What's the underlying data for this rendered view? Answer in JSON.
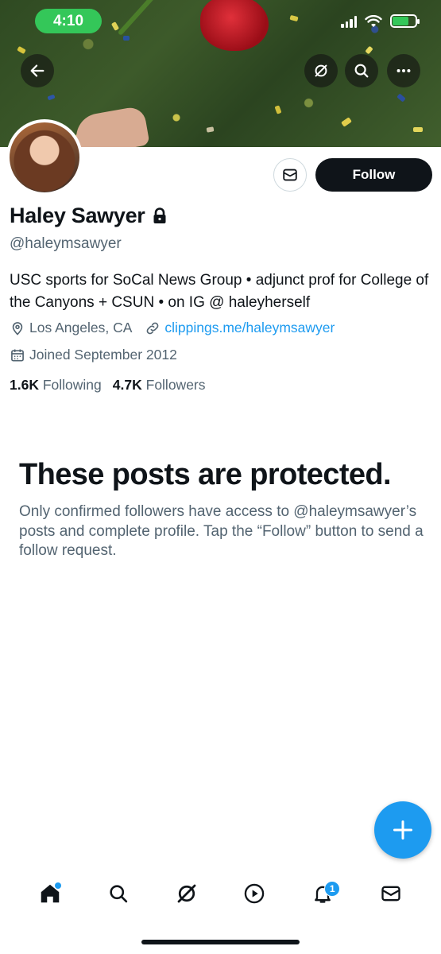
{
  "status_bar": {
    "time": "4:10"
  },
  "profile": {
    "name": "Haley Sawyer",
    "handle": "@haleymsawyer",
    "bio": "USC sports for SoCal News Group • adjunct prof for College of the Canyons + CSUN • on IG @ haleyherself",
    "location": "Los Angeles, CA",
    "website": "clippings.me/haleymsawyer",
    "joined": "Joined September 2012",
    "following_count": "1.6K",
    "following_label": "Following",
    "followers_count": "4.7K",
    "followers_label": "Followers",
    "protected": true
  },
  "actions": {
    "follow_label": "Follow"
  },
  "protected_notice": {
    "title": "These posts are protected.",
    "body": "Only confirmed followers have access to @haleymsawyer’s posts and complete profile. Tap the “Follow” button to send a follow request."
  },
  "tabbar": {
    "items": [
      {
        "name": "home",
        "icon": "home-icon"
      },
      {
        "name": "search",
        "icon": "search-icon"
      },
      {
        "name": "grok",
        "icon": "grok-icon"
      },
      {
        "name": "videos",
        "icon": "play-icon"
      },
      {
        "name": "notifications",
        "icon": "bell-icon"
      },
      {
        "name": "messages",
        "icon": "mail-icon"
      }
    ],
    "notifications_badge": "1"
  },
  "colors": {
    "accent": "#1d9bf0",
    "text": "#0f1419",
    "muted": "#536471",
    "status_green": "#34c759"
  }
}
